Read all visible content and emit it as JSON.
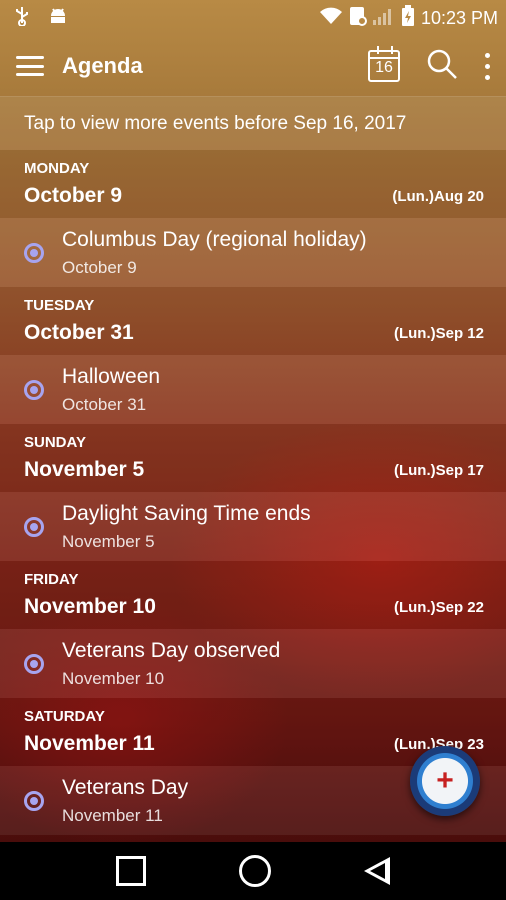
{
  "status_bar": {
    "time": "10:23 PM",
    "icons": [
      "usb-icon",
      "android-icon",
      "wifi-icon",
      "nfc-icon",
      "signal-icon",
      "battery-icon"
    ]
  },
  "app_bar": {
    "title": "Agenda",
    "calendar_day": "16",
    "icons": [
      "menu-icon",
      "calendar-today-icon",
      "search-icon",
      "more-vert-icon"
    ]
  },
  "banner": {
    "text": "Tap to view more events before Sep 16, 2017"
  },
  "days": [
    {
      "day_name": "MONDAY",
      "date": "October 9",
      "lunar": "(Lun.)Aug 20",
      "event": {
        "title": "Columbus Day (regional holiday)",
        "date": "October 9"
      }
    },
    {
      "day_name": "TUESDAY",
      "date": "October 31",
      "lunar": "(Lun.)Sep 12",
      "event": {
        "title": "Halloween",
        "date": "October 31"
      }
    },
    {
      "day_name": "SUNDAY",
      "date": "November 5",
      "lunar": "(Lun.)Sep 17",
      "event": {
        "title": "Daylight Saving Time ends",
        "date": "November 5"
      }
    },
    {
      "day_name": "FRIDAY",
      "date": "November 10",
      "lunar": "(Lun.)Sep 22",
      "event": {
        "title": "Veterans Day observed",
        "date": "November 10"
      }
    },
    {
      "day_name": "SATURDAY",
      "date": "November 11",
      "lunar": "(Lun.)Sep 23",
      "event": {
        "title": "Veterans Day",
        "date": "November 11"
      }
    }
  ],
  "fab": {
    "icon": "add-icon"
  },
  "colors": {
    "event_dot": "#a7a4ef",
    "fab_plus": "#c62020"
  }
}
